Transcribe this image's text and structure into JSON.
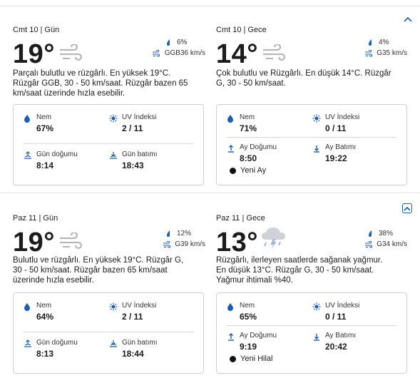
{
  "colors": {
    "accent": "#1a5fb4",
    "icon": "#1a5fb4",
    "border": "#cfcfcf"
  },
  "days": [
    {
      "day": {
        "header": "Cmt 10 | Gün",
        "temp": "19°",
        "icon": "wind-icon",
        "precip": "6%",
        "wind": "GGB36 km/s",
        "desc": "Parçalı bulutlu ve rüzgârlı. En yüksek 19°C. Rüzgâr GGB, 30 - 50 km/saat. Rüzgâr bazen 65 km/saat üzerinde hızla esebilir.",
        "card": {
          "humidity_label": "Nem",
          "humidity": "67%",
          "uv_label": "UV İndeksi",
          "uv": "2 / 11",
          "rise_label": "Gün doğumu",
          "rise": "8:14",
          "set_label": "Gün batımı",
          "set": "18:43"
        }
      },
      "night": {
        "header": "Cmt 10 | Gece",
        "temp": "14°",
        "icon": "wind-icon",
        "precip": "4%",
        "wind": "G35 km/s",
        "desc": "Çok bulutlu ve Rüzgârlı. En düşük 14°C. Rüzgâr G, 30 - 50 km/saat.",
        "card": {
          "humidity_label": "Nem",
          "humidity": "71%",
          "uv_label": "UV İndeksi",
          "uv": "0 / 11",
          "rise_label": "Ay Doğumu",
          "rise": "8:50",
          "set_label": "Ay Batımı",
          "set": "19:22",
          "moon_phase": "Yeni Ay"
        }
      }
    },
    {
      "day": {
        "header": "Paz 11 | Gün",
        "temp": "19°",
        "icon": "wind-icon",
        "precip": "12%",
        "wind": "G39 km/s",
        "desc": "Bulutlu ve rüzgârlı. En yüksek 19°C. Rüzgâr G, 30 - 50 km/saat. Rüzgâr bazen 65 km/saat üzerinde hızla esebilir.",
        "card": {
          "humidity_label": "Nem",
          "humidity": "64%",
          "uv_label": "UV İndeksi",
          "uv": "2 / 11",
          "rise_label": "Gün doğumu",
          "rise": "8:13",
          "set_label": "Gün batımı",
          "set": "18:44"
        }
      },
      "night": {
        "header": "Paz 11 | Gece",
        "temp": "13°",
        "icon": "thunderstorm-icon",
        "precip": "38%",
        "wind": "G34 km/s",
        "desc": "Rüzgârlı, ilerleyen saatlerde sağanak yağmur. En düşük 13°C. Rüzgâr G, 30 - 50 km/saat. Yağmur ihtimali %40.",
        "card": {
          "humidity_label": "Nem",
          "humidity": "65%",
          "uv_label": "UV İndeksi",
          "uv": "0 / 11",
          "rise_label": "Ay Doğumu",
          "rise": "9:19",
          "set_label": "Ay Batımı",
          "set": "20:42",
          "moon_phase": "Yeni Hilal"
        }
      }
    }
  ]
}
